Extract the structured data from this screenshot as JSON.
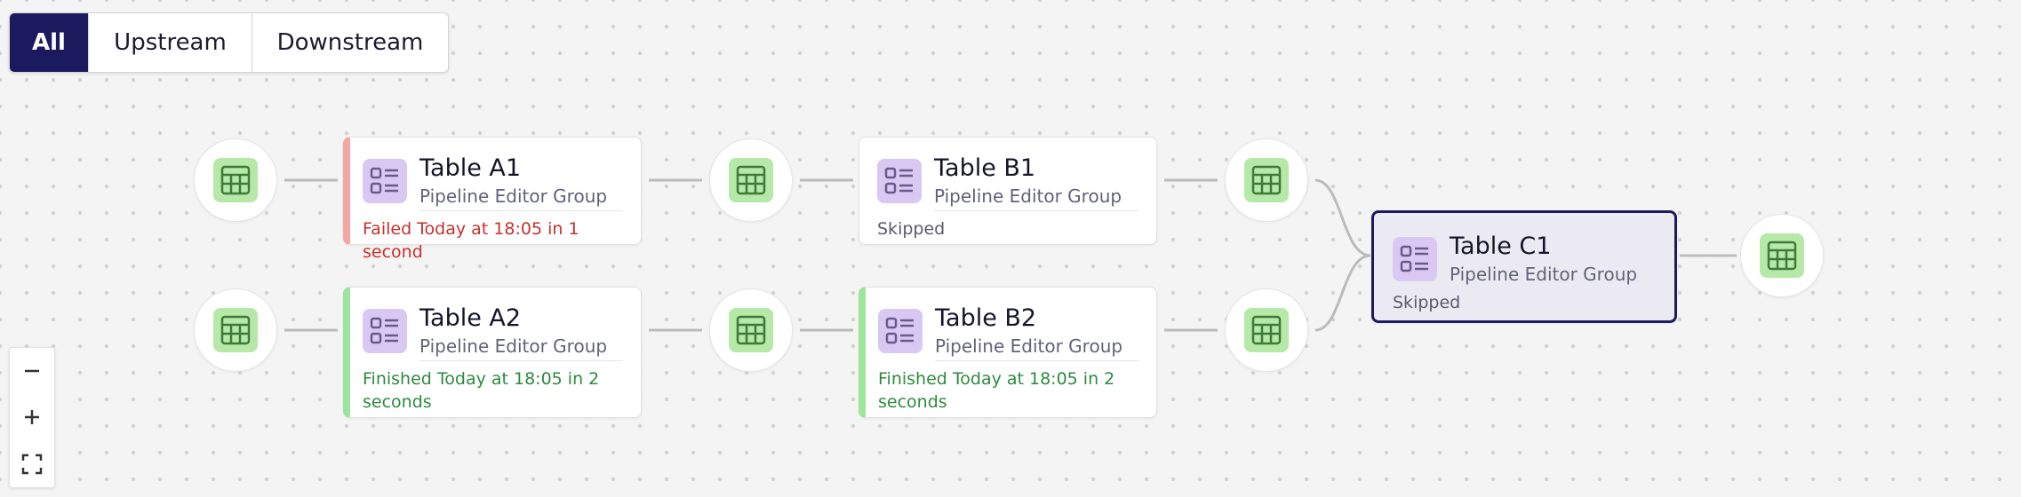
{
  "filters": {
    "all": "All",
    "upstream": "Upstream",
    "downstream": "Downstream",
    "active": "all"
  },
  "nodes": {
    "a1": {
      "title": "Table A1",
      "group": "Pipeline Editor Group",
      "status": "Failed Today at 18:05 in 1 second",
      "state": "failed"
    },
    "a2": {
      "title": "Table A2",
      "group": "Pipeline Editor Group",
      "status_line1": "Finished Today at 18:05 in 2",
      "status_line2": "seconds",
      "state": "finished"
    },
    "b1": {
      "title": "Table B1",
      "group": "Pipeline Editor Group",
      "status": "Skipped",
      "state": "skipped"
    },
    "b2": {
      "title": "Table B2",
      "group": "Pipeline Editor Group",
      "status_line1": "Finished Today at 18:05 in 2",
      "status_line2": "seconds",
      "state": "finished"
    },
    "c1": {
      "title": "Table C1",
      "group": "Pipeline Editor Group",
      "status": "Skipped",
      "state": "skipped"
    }
  },
  "zoom_controls": {
    "zoom_out": "zoom-out",
    "zoom_in": "zoom-in",
    "fit_view": "fit-view"
  },
  "colors": {
    "accent": "#1c1a5e",
    "failed": "#c9302c",
    "finished": "#2d8a3e",
    "source_icon_bg": "#b6e8a8",
    "job_icon_bg": "#d8c8f2",
    "edge": "#bbbbbb"
  }
}
